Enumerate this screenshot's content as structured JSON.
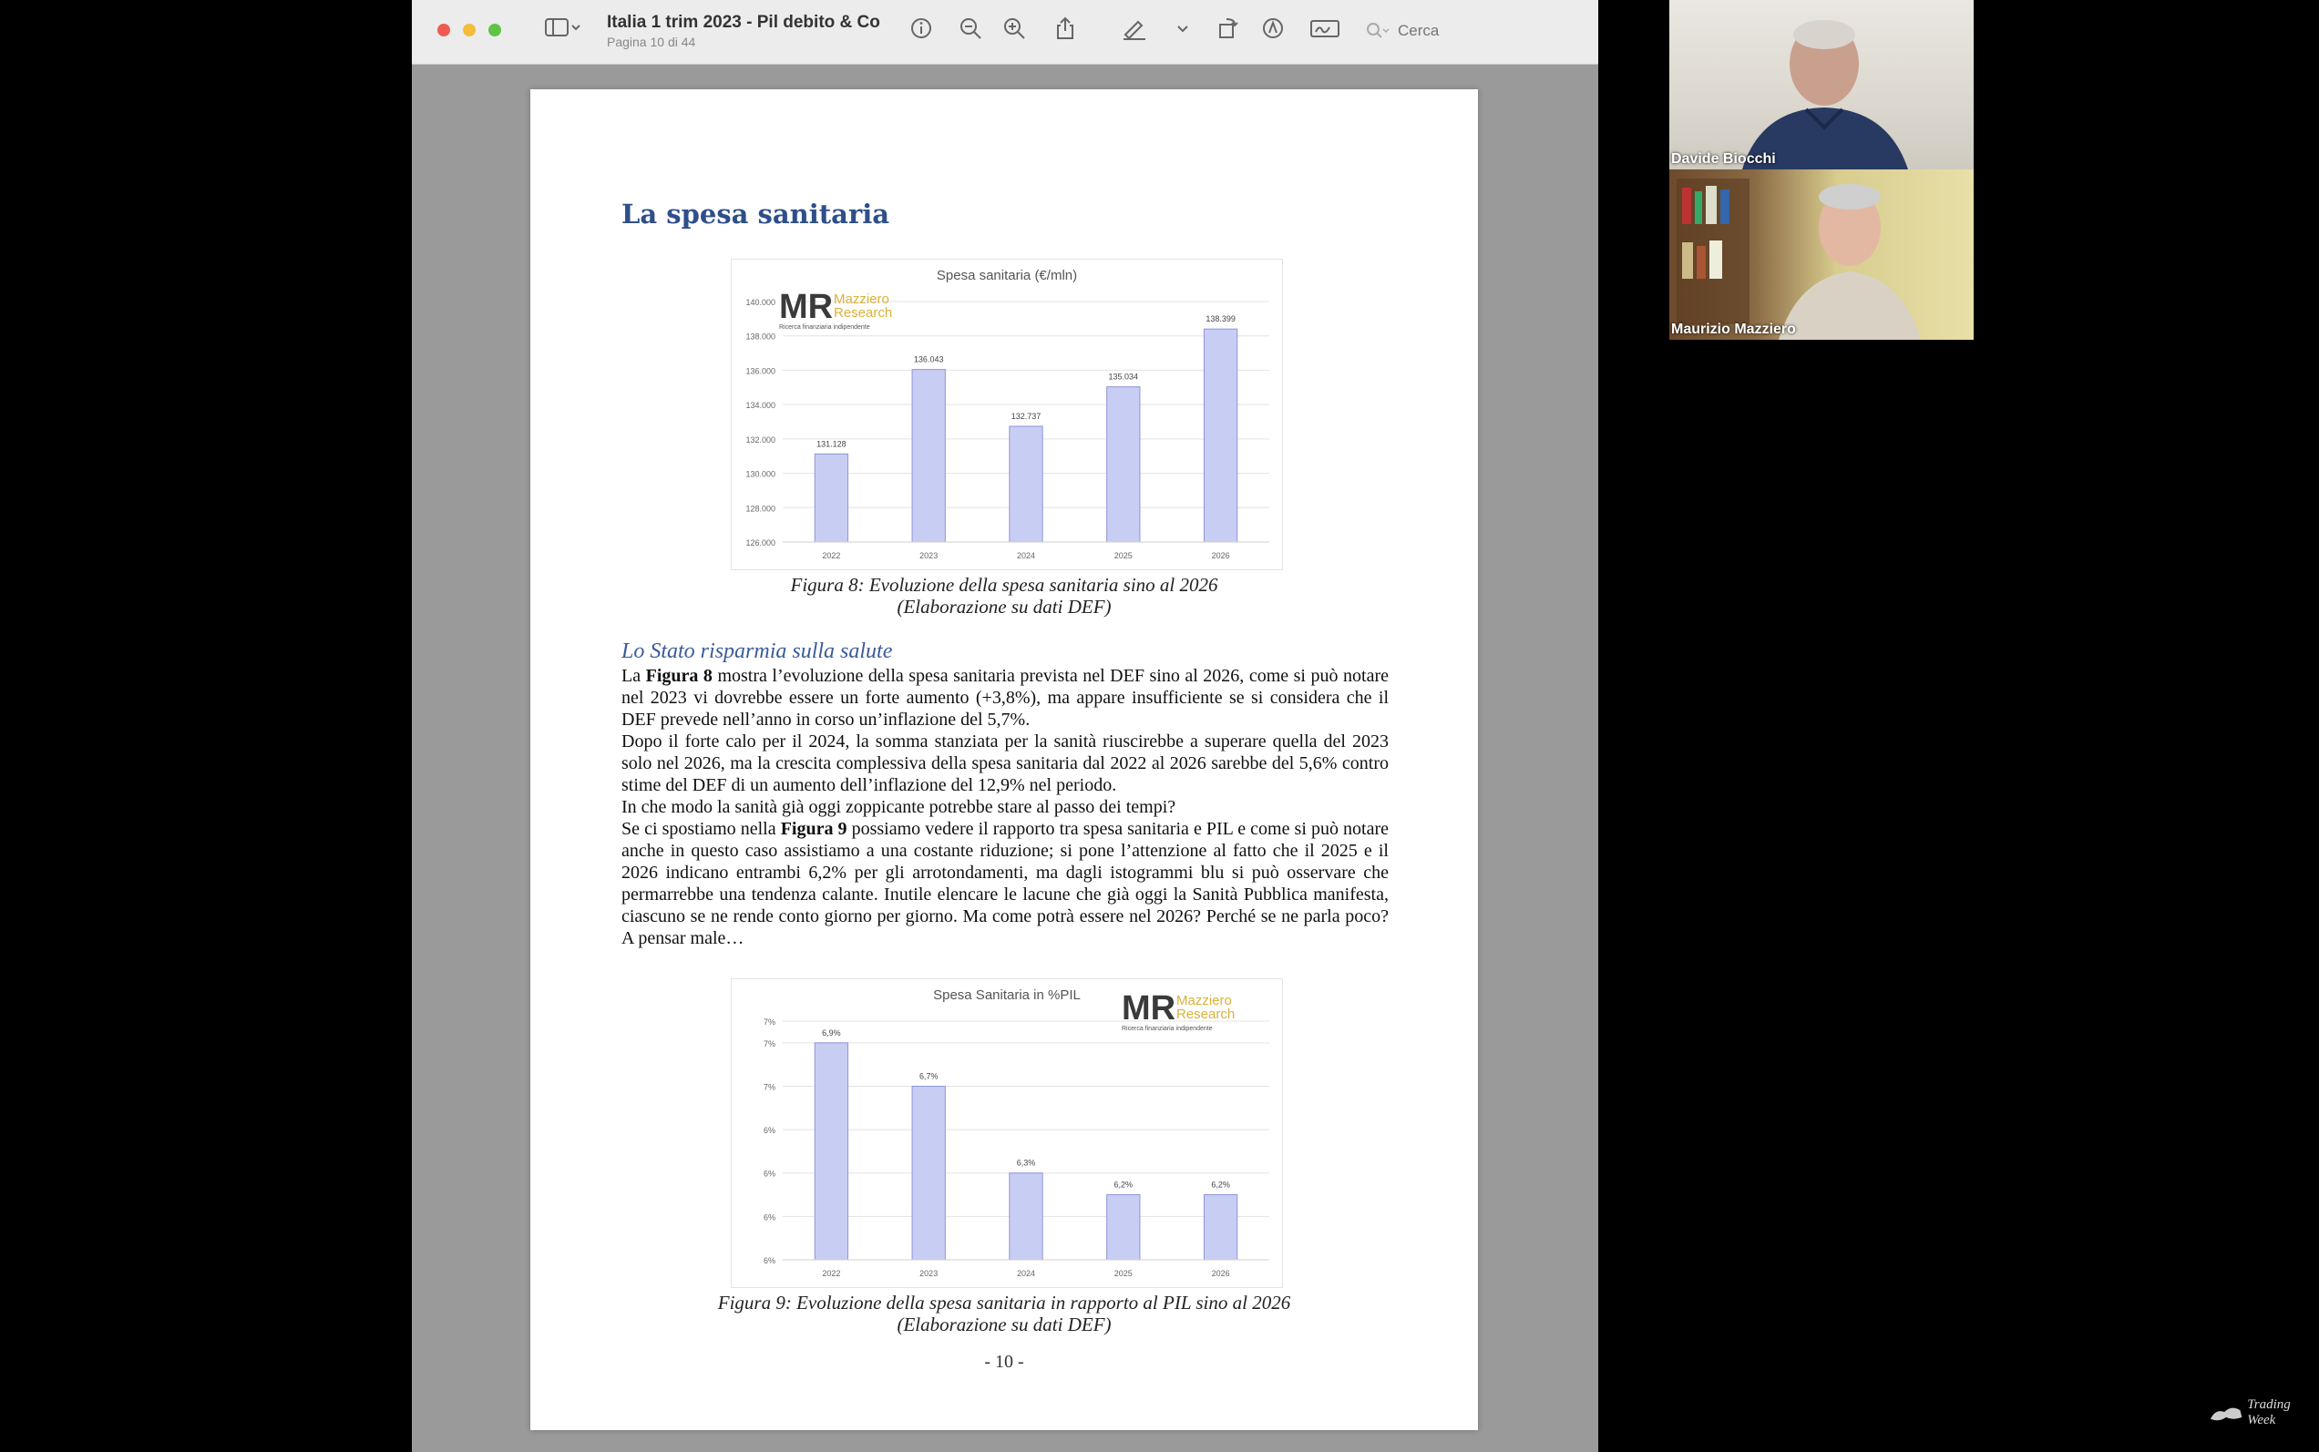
{
  "window": {
    "title": "Italia 1 trim 2023 - Pil debito & Co",
    "subtitle": "Pagina 10 di 44",
    "search_placeholder": "Cerca"
  },
  "page": {
    "heading": "La spesa sanitaria",
    "figure8_caption_line1": "Figura 8: Evoluzione della spesa sanitaria sino al 2026",
    "figure8_caption_line2": "(Elaborazione su dati DEF)",
    "section_title": "Lo Stato risparmia sulla salute",
    "p1_pre": "La ",
    "p1_bold": "Figura 8",
    "p1_post": " mostra l’evoluzione della spesa sanitaria prevista nel DEF sino al 2026, come si può notare nel 2023 vi dovrebbe essere un forte aumento (+3,8%), ma appare insufficiente se si considera che il DEF prevede nell’anno in corso un’inflazione del 5,7%.",
    "p2": "Dopo il forte calo per il 2024, la somma stanziata per la sanità riuscirebbe a superare quella del 2023 solo nel 2026, ma la crescita complessiva della spesa sanitaria dal 2022 al 2026 sarebbe del 5,6% contro stime del DEF di un aumento dell’inflazione del 12,9% nel periodo.",
    "p3": "In che modo la sanità già oggi zoppicante potrebbe stare al passo dei tempi?",
    "p4_pre": "Se ci spostiamo nella ",
    "p4_bold": "Figura 9",
    "p4_post": " possiamo vedere il rapporto tra spesa sanitaria e PIL e come si può notare anche in questo caso assistiamo a una costante riduzione; si pone l’attenzione al fatto che il 2025 e il 2026 indicano entrambi 6,2% per gli arrotondamenti, ma dagli istogrammi blu si può osservare che permarrebbe una tendenza calante. Inutile elencare le lacune che già oggi la Sanità Pubblica manifesta, ciascuno se ne rende conto giorno per giorno. Ma come potrà essere nel 2026? Perché se ne parla poco? A pensar male…",
    "figure9_caption_line1": "Figura 9: Evoluzione della spesa sanitaria in rapporto al PIL sino al 2026",
    "figure9_caption_line2": "(Elaborazione su dati DEF)",
    "page_number": "- 10 -"
  },
  "logo": {
    "mark": "MR",
    "line1": "Mazziero",
    "line2": "Research",
    "tagline": "Ricerca finanziaria indipendente"
  },
  "participants": [
    {
      "name": "Davide Biocchi"
    },
    {
      "name": "Maurizio Mazziero"
    }
  ],
  "brand": "Trading Week",
  "colors": {
    "bar_fill": "#c8cdf4",
    "bar_stroke": "#8e96d8",
    "heading": "#2e4f8a",
    "logo_gold": "#d9b23a",
    "logo_dark": "#3a3a3a"
  },
  "chart_data": [
    {
      "type": "bar",
      "title": "Spesa sanitaria (€/mln)",
      "categories": [
        "2022",
        "2023",
        "2024",
        "2025",
        "2026"
      ],
      "values": [
        131128,
        136043,
        132737,
        135034,
        138399
      ],
      "value_labels": [
        "131.128",
        "136.043",
        "132.737",
        "135.034",
        "138.399"
      ],
      "ylim": [
        126000,
        140000
      ],
      "yticks": [
        126000,
        128000,
        130000,
        132000,
        134000,
        136000,
        138000,
        140000
      ],
      "ytick_labels": [
        "126.000",
        "128.000",
        "130.000",
        "132.000",
        "134.000",
        "136.000",
        "138.000",
        "140.000"
      ],
      "grid": true,
      "legend": "none"
    },
    {
      "type": "bar",
      "title": "Spesa Sanitaria in %PIL",
      "categories": [
        "2022",
        "2023",
        "2024",
        "2025",
        "2026"
      ],
      "values": [
        6.9,
        6.7,
        6.3,
        6.2,
        6.2
      ],
      "value_labels": [
        "6,9%",
        "6,7%",
        "6,3%",
        "6,2%",
        "6,2%"
      ],
      "ylim": [
        5.9,
        7.0
      ],
      "yticks": [
        5.9,
        6.1,
        6.3,
        6.5,
        6.7,
        6.9,
        7.0
      ],
      "ytick_labels": [
        "6%",
        "6%",
        "6%",
        "6%",
        "7%",
        "7%",
        "7%"
      ],
      "grid": true,
      "legend": "none"
    }
  ]
}
